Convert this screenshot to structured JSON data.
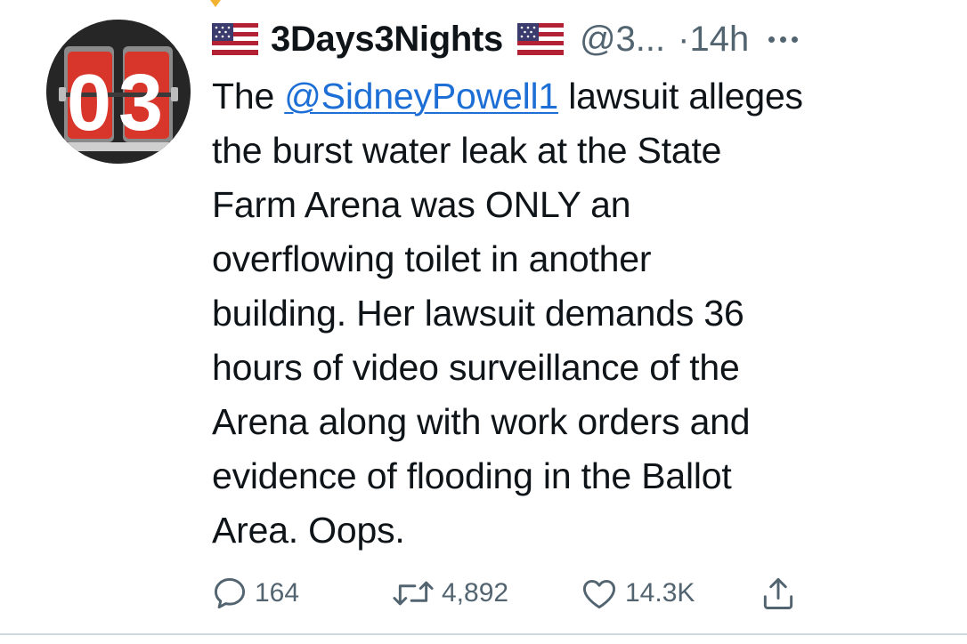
{
  "tweet": {
    "display_name": "3Days3Nights",
    "handle": "@3...",
    "separator": "·",
    "time": "14h",
    "body_before_mention": "The ",
    "mention": "@SidneyPowell1",
    "body_line1_after": " lawsuit alleges",
    "body_lines": [
      "the burst water leak at the State",
      "Farm Arena was ONLY an",
      "overflowing toilet in another",
      "building. Her lawsuit demands 36",
      "hours of video surveillance of the",
      "Arena along with work orders and",
      "evidence of flooding in the Ballot",
      "Area. Oops."
    ]
  },
  "avatar": {
    "digits": "03"
  },
  "actions": {
    "replies": "164",
    "retweets": "4,892",
    "likes": "14.3K"
  },
  "colors": {
    "text": "#0f1419",
    "secondary": "#536471",
    "link": "#1d6fd6",
    "avatar_tile": "#d9362b"
  },
  "icons": {
    "flag": "us-flag-icon",
    "more": "more-horizontal-icon",
    "reply": "reply-icon",
    "retweet": "retweet-icon",
    "like": "like-icon",
    "share": "share-icon"
  }
}
